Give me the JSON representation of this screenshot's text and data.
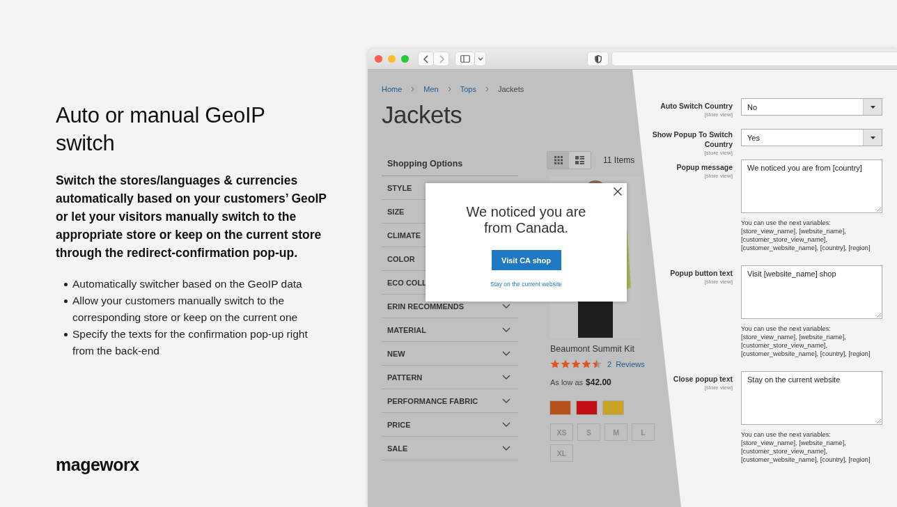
{
  "slide": {
    "heading": "Auto or manual GeoIP switch",
    "description": "Switch the stores/languages & currencies automatically based on your customers’ GeoIP or let your visitors manually switch to the appropriate store or keep on the current store through the redirect-confirmation pop-up.",
    "bullets": [
      "Automatically switcher based on the GeoIP data",
      "Allow your customers manually switch to the corresponding store or keep on the current one",
      "Specify the texts for the confirmation pop-up right from the back-end"
    ],
    "logo": "mageworx"
  },
  "store": {
    "breadcrumbs": [
      {
        "label": "Home",
        "link": true
      },
      {
        "label": "Men",
        "link": true
      },
      {
        "label": "Tops",
        "link": true
      },
      {
        "label": "Jackets",
        "link": false
      }
    ],
    "page_title": "Jackets",
    "filters": {
      "title": "Shopping Options",
      "items": [
        {
          "label": "STYLE"
        },
        {
          "label": "SIZE"
        },
        {
          "label": "CLIMATE"
        },
        {
          "label": "COLOR"
        },
        {
          "label": "ECO COLL"
        },
        {
          "label": "ERIN RECOMMENDS",
          "chevron": true
        },
        {
          "label": "MATERIAL",
          "chevron": true
        },
        {
          "label": "NEW",
          "chevron": true
        },
        {
          "label": "PATTERN",
          "chevron": true
        },
        {
          "label": "PERFORMANCE FABRIC",
          "chevron": true
        },
        {
          "label": "PRICE",
          "chevron": true
        },
        {
          "label": "SALE",
          "chevron": true
        }
      ]
    },
    "view_modes": [
      {
        "kind": "grid",
        "selected": true
      },
      {
        "kind": "list",
        "selected": false
      }
    ],
    "count": "11 Items",
    "product": {
      "name": "Beaumont Summit Kit",
      "stars": 4.5,
      "reviews_count": "2",
      "reviews_label": "Reviews",
      "price_prefix": "As low as",
      "price": "$42.00",
      "swatches": [
        {
          "color": "#b5501a"
        },
        {
          "color": "#c40e15"
        },
        {
          "color": "#c9a224"
        }
      ],
      "sizes": [
        "XS",
        "S",
        "M",
        "L",
        "XL"
      ]
    },
    "popup": {
      "message": "We noticed you are from Canada.",
      "button": "Visit CA shop",
      "link": "Stay on the current website"
    }
  },
  "admin": {
    "fields": [
      {
        "kind": "select",
        "label": "Auto Switch Country",
        "scope": "[store view]",
        "value": "No"
      },
      {
        "kind": "select",
        "label": "Show Popup To Switch Country",
        "scope": "[store view]",
        "value": "Yes"
      },
      {
        "kind": "textarea",
        "label": "Popup message",
        "scope": "[store view]",
        "value": "We noticed you are from [country]",
        "note": "You can use the next variables: [store_view_name], [website_name], [customer_store_view_name], [customer_website_name], [country], [region]"
      },
      {
        "kind": "textarea",
        "label": "Popup button text",
        "scope": "[store view]",
        "value": "Visit [website_name] shop",
        "note": "You can use the next variables: [store_view_name], [website_name], [customer_store_view_name], [customer_website_name], [country], [region]"
      },
      {
        "kind": "textarea",
        "label": "Close popup text",
        "scope": "[store view]",
        "value": "Stay on the current website",
        "note": "You can use the next variables: [store_view_name], [website_name], [customer_store_view_name], [customer_website_name], [country], [region]"
      }
    ]
  }
}
